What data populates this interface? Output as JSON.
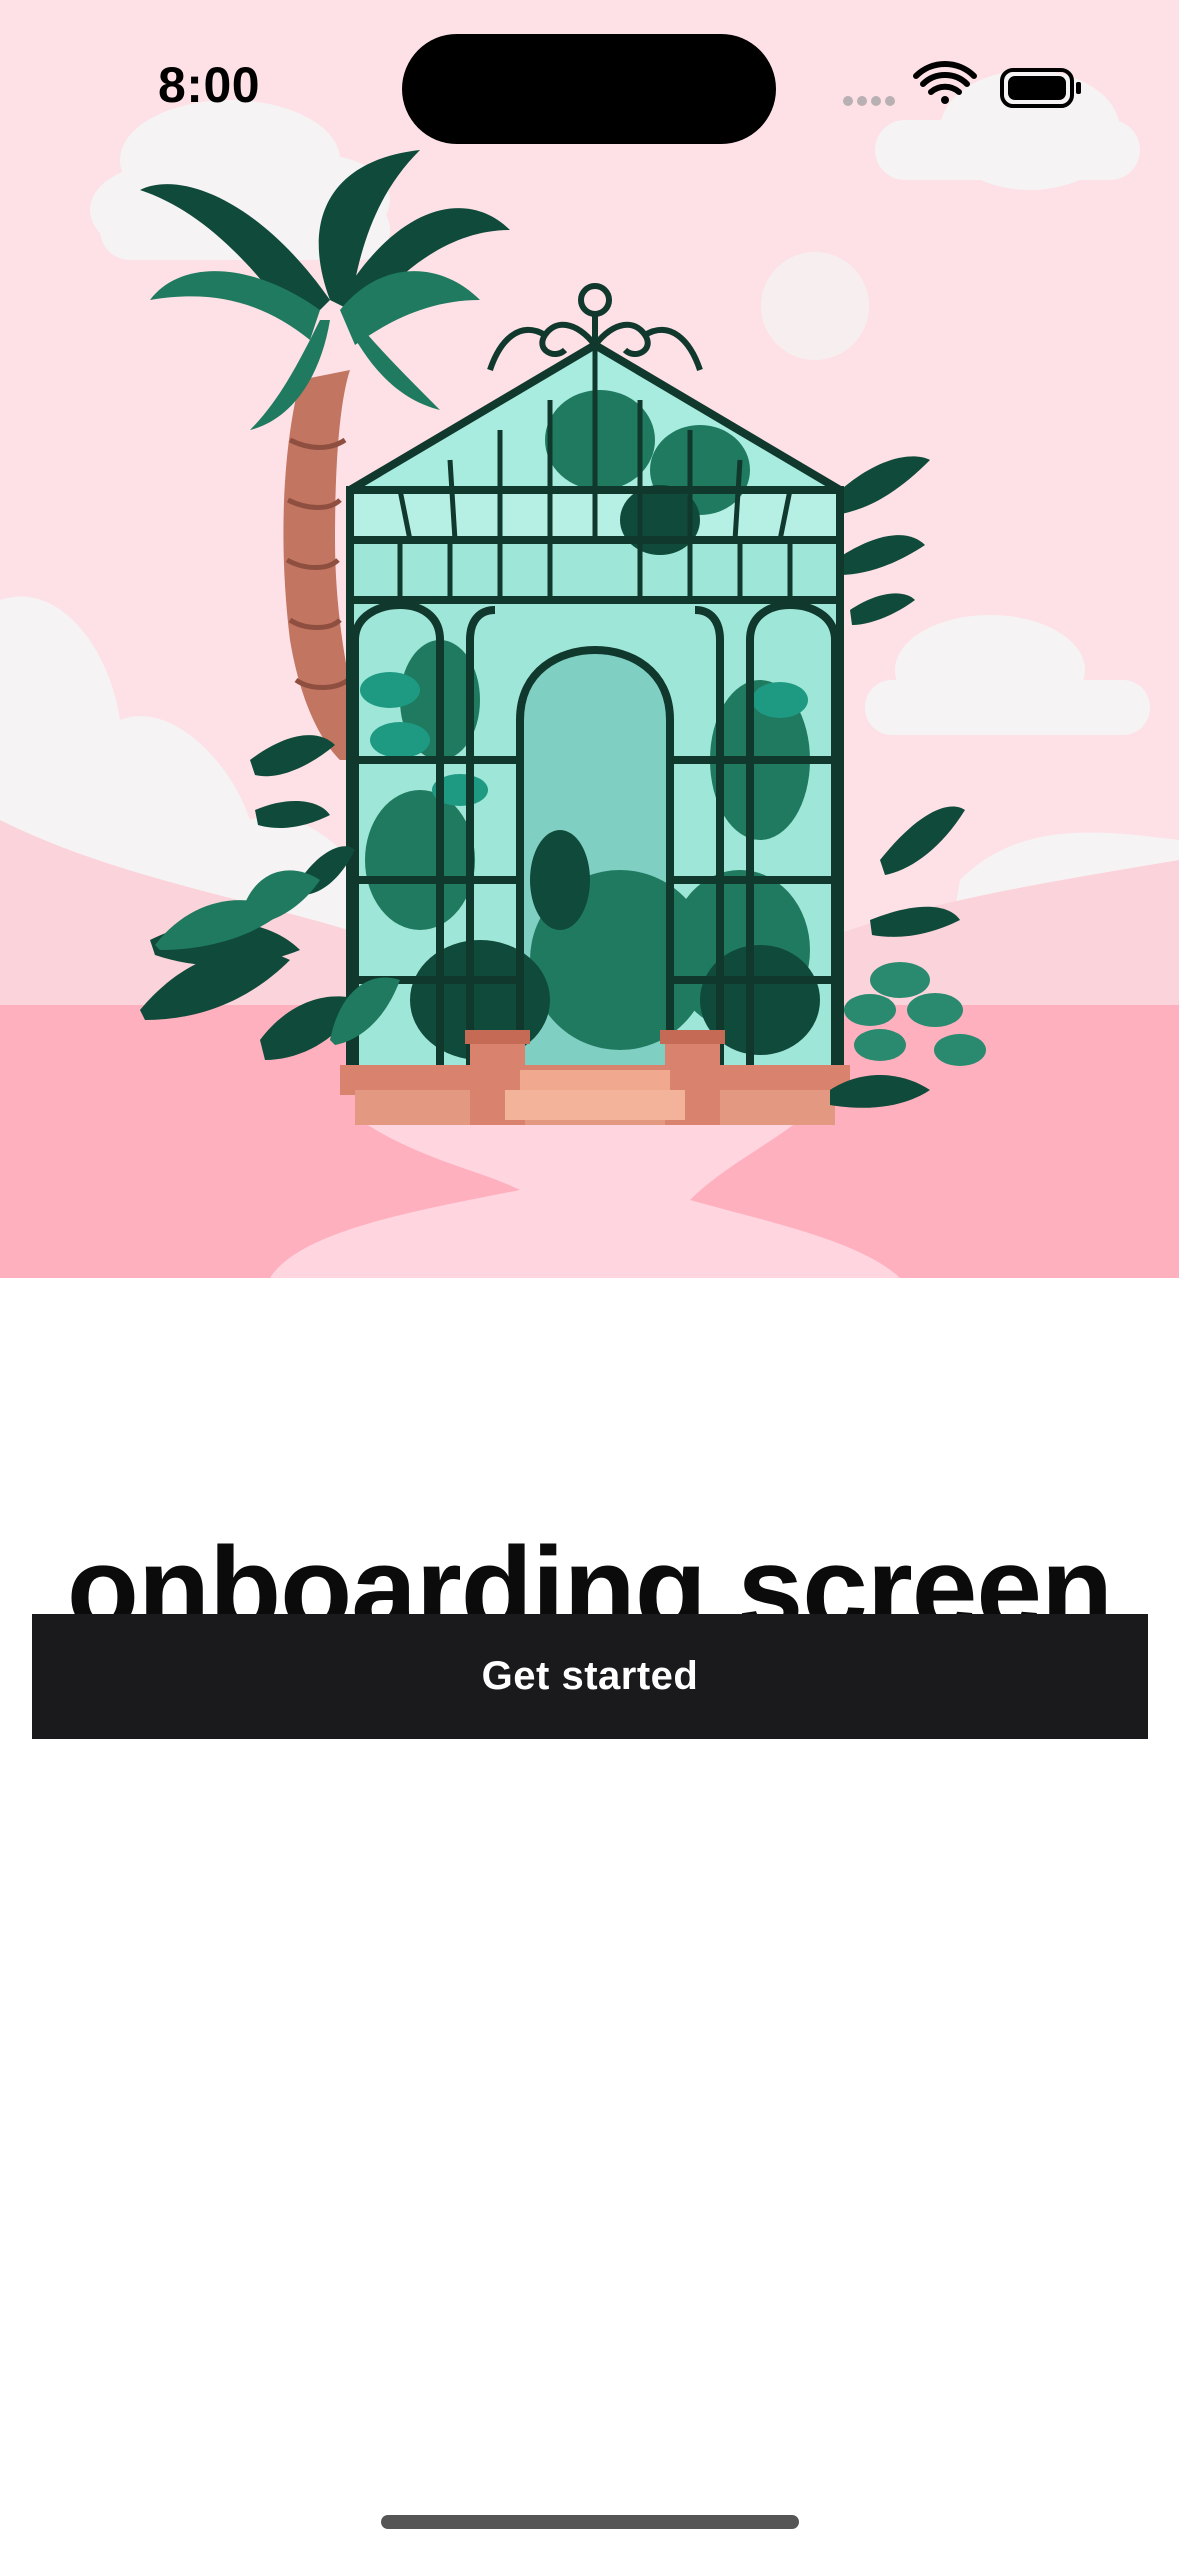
{
  "status_bar": {
    "time": "8:00"
  },
  "hero": {
    "illustration": "greenhouse-illustration",
    "colors": {
      "sky": "#fde1e6",
      "ground": "#ffb0bf",
      "path": "#ffd6df",
      "glass": "#9ee6d8",
      "frame": "#10382d",
      "leaf_dark": "#0f4a3a",
      "leaf_mid": "#1f7a5f",
      "brick": "#d9826e"
    }
  },
  "main": {
    "title": "onboarding screen",
    "cta_label": "Get started"
  }
}
